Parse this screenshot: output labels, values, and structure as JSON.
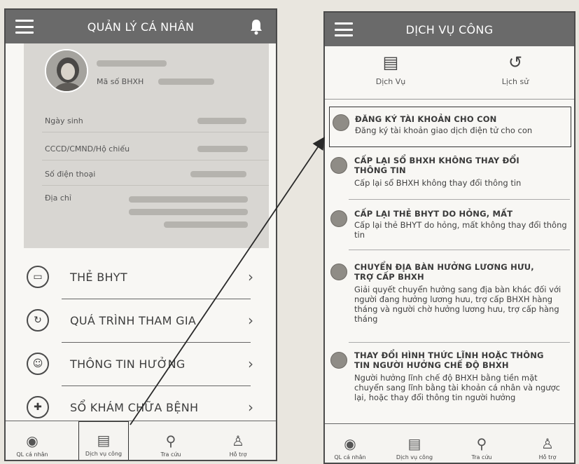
{
  "left_screen": {
    "header_title": "QUẢN LÝ CÁ NHÂN",
    "profile": {
      "bhxh_label": "Mã số BHXH",
      "fields": [
        {
          "label": "Ngày sinh"
        },
        {
          "label": "CCCD/CMND/Hộ chiếu"
        },
        {
          "label": "Số điện thoại"
        },
        {
          "label": "Địa chỉ"
        }
      ]
    },
    "menu": [
      {
        "label": "THẺ BHYT",
        "icon": "card-icon"
      },
      {
        "label": "QUÁ TRÌNH THAM GIA",
        "icon": "history-icon"
      },
      {
        "label": "THÔNG TIN HƯỞNG",
        "icon": "person-icon"
      },
      {
        "label": "SỔ KHÁM CHỮA BỆNH",
        "icon": "medical-cross-icon"
      }
    ],
    "bottom_nav": [
      {
        "label": "QL cá nhân",
        "icon": "profile-badge-icon"
      },
      {
        "label": "Dịch vụ công",
        "icon": "document-icon"
      },
      {
        "label": "Tra cứu",
        "icon": "search-icon"
      },
      {
        "label": "Hỗ trợ",
        "icon": "support-icon"
      }
    ]
  },
  "right_screen": {
    "header_title": "DỊCH VỤ CÔNG",
    "tabs": [
      {
        "label": "Dịch Vụ",
        "icon": "document-icon"
      },
      {
        "label": "Lịch sử",
        "icon": "history-icon"
      }
    ],
    "services": [
      {
        "title": "ĐĂNG KÝ TÀI KHOẢN CHO CON",
        "desc": "Đăng ký tài khoản giao dịch điện tử cho con"
      },
      {
        "title": "CẤP LẠI SỔ BHXH KHÔNG THAY ĐỔI THÔNG TIN",
        "desc": "Cấp lại sổ BHXH không thay đổi thông tin"
      },
      {
        "title": "CẤP LẠI THẺ BHYT DO HỎNG, MẤT",
        "desc": "Cấp lại thẻ BHYT do hỏng, mất không thay đổi thông tin"
      },
      {
        "title": "CHUYỂN ĐỊA BÀN HƯỞNG LƯƠNG HƯU, TRỢ CẤP BHXH",
        "desc": "Giải quyết chuyển hưởng sang địa bàn khác đối với người đang hưởng lương hưu, trợ cấp BHXH hàng tháng và người chờ hưởng lương hưu, trợ cấp hàng tháng"
      },
      {
        "title": "THAY ĐỔI HÌNH THỨC LĨNH HOẶC THÔNG TIN NGƯỜI HƯỞNG CHẾ ĐỘ BHXH",
        "desc": "Người hưởng lĩnh chế độ BHXH bằng tiền mặt chuyển sang lĩnh bằng tài khoản cá nhân và ngược lại, hoặc thay đổi thông tin người hưởng"
      }
    ],
    "bottom_nav": [
      {
        "label": "QL cá nhân",
        "icon": "profile-badge-icon"
      },
      {
        "label": "Dịch vụ công",
        "icon": "document-icon"
      },
      {
        "label": "Tra cứu",
        "icon": "search-icon"
      },
      {
        "label": "Hỗ trợ",
        "icon": "support-icon"
      }
    ]
  }
}
